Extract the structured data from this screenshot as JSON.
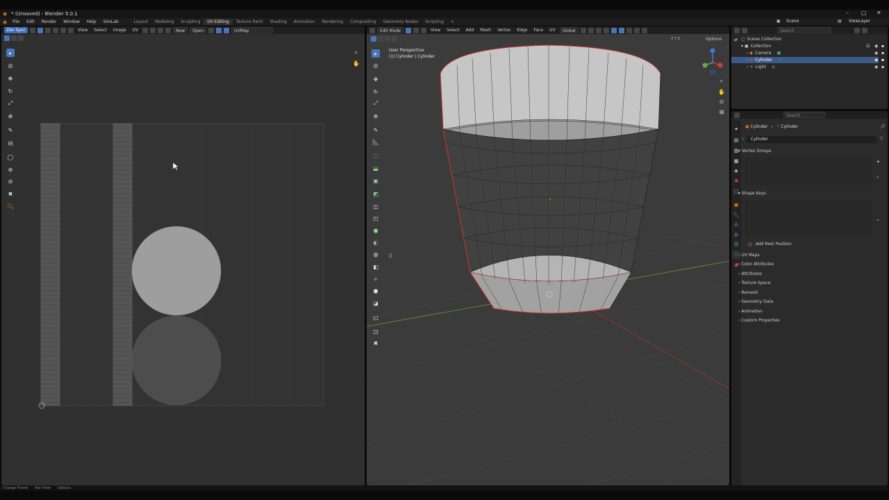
{
  "window": {
    "title": "* (Unsaved) - Blender 5.0.1",
    "min": "–",
    "max": "□",
    "close": "✕"
  },
  "menu": [
    "File",
    "Edit",
    "Render",
    "Window",
    "Help",
    "SimLab"
  ],
  "workspaces": [
    "Layout",
    "Modeling",
    "Sculpting",
    "UV Editing",
    "Texture Paint",
    "Shading",
    "Animation",
    "Rendering",
    "Compositing",
    "Geometry Nodes",
    "Scripting",
    "+"
  ],
  "active_workspace": "UV Editing",
  "scene": {
    "scene_label": "Scene",
    "view_layer": "ViewLayer",
    "search_placeholder": "Search"
  },
  "uv_editor": {
    "zen_label": "Zen Sync",
    "menus": [
      "View",
      "Select",
      "Image",
      "UV"
    ],
    "new_label": "New",
    "open_label": "Open",
    "uvmap_label": "UVMap",
    "accent": "#3f6fb4"
  },
  "viewport": {
    "mode_label": "Edit Mode",
    "menus": [
      "View",
      "Select",
      "Add",
      "Mesh",
      "Vertex",
      "Edge",
      "Face",
      "UV"
    ],
    "orientation": "Global",
    "options_label": "Options",
    "overlay_line1": "User Perspective",
    "overlay_line2": "(1) Cylinder | Cylinder",
    "axes": {
      "x": "X",
      "y": "Y",
      "z": "Z"
    }
  },
  "outliner": {
    "root": "Scene Collection",
    "items": [
      {
        "label": "Collection"
      },
      {
        "label": "Camera"
      },
      {
        "label": "Cylinder",
        "selected": true
      },
      {
        "label": "Light"
      }
    ]
  },
  "properties": {
    "search_placeholder": "Search",
    "breadcrumb_obj": "Cylinder",
    "breadcrumb_data": "Cylinder",
    "data_name": "Cylinder",
    "vertex_groups": "Vertex Groups",
    "shape_keys": "Shape Keys",
    "add_rest": "Add Rest Position",
    "sections": [
      "UV Maps",
      "Color Attributes",
      "Attributes",
      "Texture Space",
      "Remesh",
      "Geometry Data",
      "Animation",
      "Custom Properties"
    ]
  },
  "status": {
    "left": "Change Frame",
    "mid": "Pan View",
    "right": "Options"
  }
}
